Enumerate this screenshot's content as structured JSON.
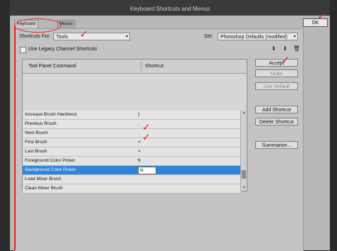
{
  "window": {
    "title": "Keyboard Shortcuts and Menus"
  },
  "tabs": [
    {
      "label": "Keyboard Shortcuts"
    },
    {
      "label": "Menus"
    }
  ],
  "shortcuts_for": {
    "label": "Shortcuts For:",
    "value": "Tools"
  },
  "set": {
    "label": "Set:",
    "value": "Photoshop Defaults (modified)"
  },
  "legacy": {
    "label": "Use Legacy Channel Shortcuts",
    "checked": false
  },
  "set_icons": [
    "save-set-icon",
    "save-set-as-icon",
    "delete-set-icon"
  ],
  "table": {
    "headers": [
      "Tool Panel Command",
      "Shortcut"
    ],
    "rows": [
      {
        "command": "Increase Brush Hardness",
        "shortcut": "}"
      },
      {
        "command": "Previous Brush",
        "shortcut": ","
      },
      {
        "command": "Next Brush",
        "shortcut": "."
      },
      {
        "command": "First Brush",
        "shortcut": "<"
      },
      {
        "command": "Last Brush",
        "shortcut": ">"
      },
      {
        "command": "Foreground Color Picker",
        "shortcut": "K"
      },
      {
        "command": "Background Color Picker",
        "shortcut": "N",
        "selected": true
      },
      {
        "command": "Load Mixer Brush",
        "shortcut": ""
      },
      {
        "command": "Clean Mixer Brush",
        "shortcut": ""
      }
    ]
  },
  "buttons": {
    "ok": "OK",
    "accept": "Accept",
    "undo": "Undo",
    "use_default": "Use Default",
    "add_shortcut": "Add Shortcut",
    "delete_shortcut": "Delete Shortcut",
    "summarize": "Summarize..."
  },
  "colors": {
    "annotation": "#e2231a",
    "selection": "#2f86d8"
  }
}
